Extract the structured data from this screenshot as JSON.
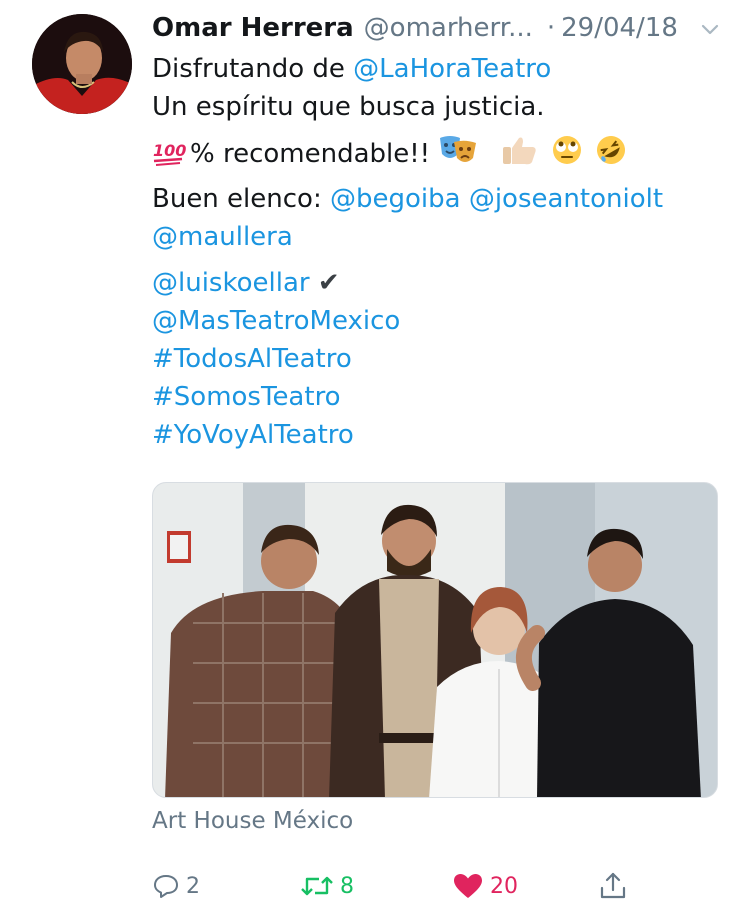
{
  "tweet": {
    "display_name": "Omar Herrera",
    "handle": "@omarherr...",
    "separator": "·",
    "date": "29/04/18",
    "text": {
      "line1_prefix": "Disfrutando de ",
      "line1_mention": "@LaHoraTeatro",
      "line2": "Un espíritu que busca justicia.",
      "line3_text": "% recomendable!!",
      "line4_prefix": "Buen elenco: ",
      "line4_mention1": "@begoiba",
      "line4_mention2": "@joseantoniolt",
      "line5_mention": "@maullera",
      "line6_mention": "@luiskoellar",
      "line6_check": "✔",
      "line7_mention": "@MasTeatroMexico",
      "hashtag1": "#TodosAlTeatro",
      "hashtag2": "#SomosTeatro",
      "hashtag3": "#YoVoyAlTeatro"
    },
    "emojis": [
      "hundred-points-emoji",
      "performing-arts-emoji",
      "thumbs-up-emoji",
      "rolling-eyes-emoji",
      "rofl-emoji"
    ],
    "location": "Art House México",
    "counts": {
      "replies": "2",
      "retweets": "8",
      "likes": "20"
    }
  },
  "colors": {
    "link": "#1b95e0",
    "muted": "#657786",
    "retweet": "#17bf63",
    "like": "#e0245e",
    "text": "#14171a"
  },
  "icons": [
    "chevron-down-icon",
    "reply-icon",
    "retweet-icon",
    "heart-icon",
    "share-icon"
  ]
}
